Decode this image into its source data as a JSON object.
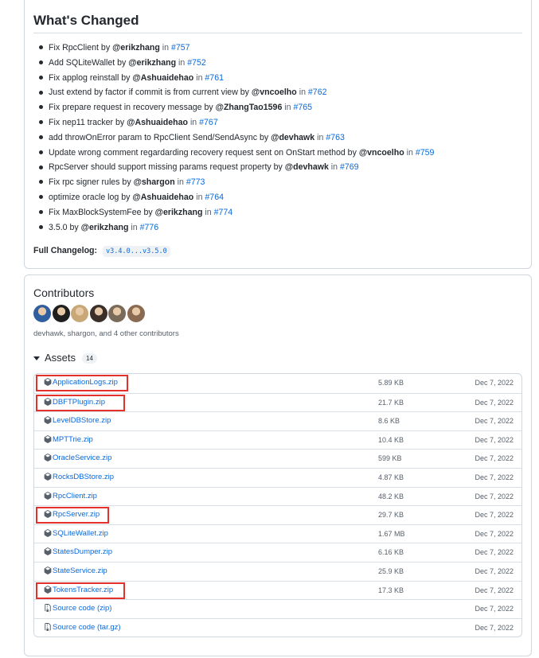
{
  "release": {
    "heading": "What's Changed",
    "changes": [
      {
        "text": "Fix RpcClient by ",
        "user": "@erikzhang",
        "in": " in ",
        "pr": "#757"
      },
      {
        "text": "Add SQLiteWallet by ",
        "user": "@erikzhang",
        "in": " in ",
        "pr": "#752"
      },
      {
        "text": "Fix applog reinstall by ",
        "user": "@Ashuaidehao",
        "in": " in ",
        "pr": "#761"
      },
      {
        "text": "Just extend by factor if commit is from current view by ",
        "user": "@vncoelho",
        "in": " in ",
        "pr": "#762"
      },
      {
        "text": "Fix prepare request in recovery message by ",
        "user": "@ZhangTao1596",
        "in": " in ",
        "pr": "#765"
      },
      {
        "text": "Fix nep11 tracker by ",
        "user": "@Ashuaidehao",
        "in": " in ",
        "pr": "#767"
      },
      {
        "text": "add throwOnError param to RpcClient Send/SendAsync by ",
        "user": "@devhawk",
        "in": " in ",
        "pr": "#763"
      },
      {
        "text": "Update wrong comment regardarding recovery request sent on OnStart method by ",
        "user": "@vncoelho",
        "in": " in ",
        "pr": "#759"
      },
      {
        "text": "RpcServer should support missing params request property by ",
        "user": "@devhawk",
        "in": " in ",
        "pr": "#769"
      },
      {
        "text": "Fix rpc signer rules by ",
        "user": "@shargon",
        "in": " in ",
        "pr": "#773"
      },
      {
        "text": "optimize oracle log by ",
        "user": "@Ashuaidehao",
        "in": " in ",
        "pr": "#764"
      },
      {
        "text": "Fix MaxBlockSystemFee by ",
        "user": "@erikzhang",
        "in": " in ",
        "pr": "#774"
      },
      {
        "text": "3.5.0 by ",
        "user": "@erikzhang",
        "in": " in ",
        "pr": "#776"
      }
    ],
    "changelog_label": "Full Changelog:",
    "changelog_range": "v3.4.0...v3.5.0"
  },
  "contributors": {
    "title": "Contributors",
    "summary": "devhawk, shargon, and 4 other contributors",
    "avatar_colors": [
      "#2f5f9e",
      "#1f1f1f",
      "#c9a878",
      "#3b2f2a",
      "#7a6a5a",
      "#8a6a50"
    ]
  },
  "assets": {
    "title": "Assets",
    "count": "14",
    "items": [
      {
        "name": "ApplicationLogs.zip",
        "size": "5.89 KB",
        "date": "Dec 7, 2022",
        "icon": "package-icon",
        "highlighted": true
      },
      {
        "name": "DBFTPlugin.zip",
        "size": "21.7 KB",
        "date": "Dec 7, 2022",
        "icon": "package-icon",
        "highlighted": true
      },
      {
        "name": "LevelDBStore.zip",
        "size": "8.6 KB",
        "date": "Dec 7, 2022",
        "icon": "package-icon",
        "highlighted": false
      },
      {
        "name": "MPTTrie.zip",
        "size": "10.4 KB",
        "date": "Dec 7, 2022",
        "icon": "package-icon",
        "highlighted": false
      },
      {
        "name": "OracleService.zip",
        "size": "599 KB",
        "date": "Dec 7, 2022",
        "icon": "package-icon",
        "highlighted": false
      },
      {
        "name": "RocksDBStore.zip",
        "size": "4.87 KB",
        "date": "Dec 7, 2022",
        "icon": "package-icon",
        "highlighted": false
      },
      {
        "name": "RpcClient.zip",
        "size": "48.2 KB",
        "date": "Dec 7, 2022",
        "icon": "package-icon",
        "highlighted": false
      },
      {
        "name": "RpcServer.zip",
        "size": "29.7 KB",
        "date": "Dec 7, 2022",
        "icon": "package-icon",
        "highlighted": true
      },
      {
        "name": "SQLiteWallet.zip",
        "size": "1.67 MB",
        "date": "Dec 7, 2022",
        "icon": "package-icon",
        "highlighted": false
      },
      {
        "name": "StatesDumper.zip",
        "size": "6.16 KB",
        "date": "Dec 7, 2022",
        "icon": "package-icon",
        "highlighted": false
      },
      {
        "name": "StateService.zip",
        "size": "25.9 KB",
        "date": "Dec 7, 2022",
        "icon": "package-icon",
        "highlighted": false
      },
      {
        "name": "TokensTracker.zip",
        "size": "17.3 KB",
        "date": "Dec 7, 2022",
        "icon": "package-icon",
        "highlighted": true
      },
      {
        "name": "Source code (zip)",
        "size": "",
        "date": "Dec 7, 2022",
        "icon": "file-zip-icon",
        "highlighted": false
      },
      {
        "name": "Source code (tar.gz)",
        "size": "",
        "date": "Dec 7, 2022",
        "icon": "file-zip-icon",
        "highlighted": false
      }
    ]
  },
  "colors": {
    "link": "#0969da",
    "text": "#24292f",
    "muted": "#57606a",
    "border": "#d0d7de",
    "highlight": "#e5312b"
  }
}
